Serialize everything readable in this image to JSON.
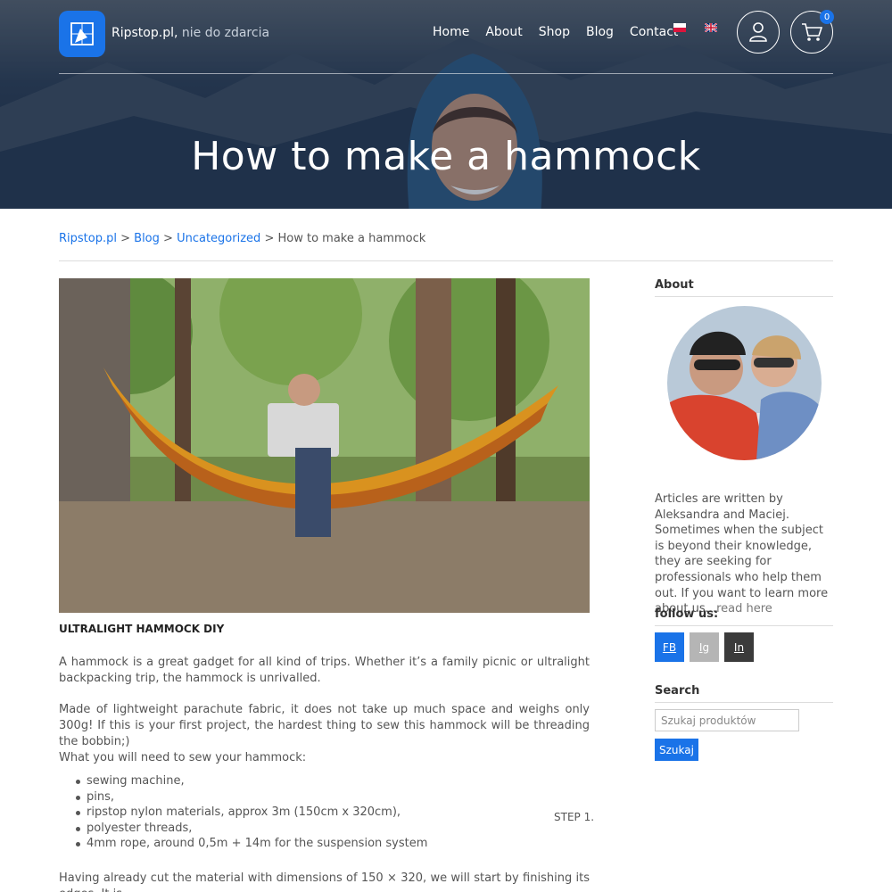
{
  "brand": {
    "name": "Ripstop.pl,",
    "tagline": "nie do zdarcia"
  },
  "nav": [
    {
      "label": "Home"
    },
    {
      "label": "About"
    },
    {
      "label": "Shop"
    },
    {
      "label": "Blog"
    },
    {
      "label": "Contact"
    }
  ],
  "cart": {
    "count": "0"
  },
  "hero": {
    "title": "How to make a hammock"
  },
  "breadcrumb": {
    "items": [
      "Ripstop.pl",
      "Blog",
      "Uncategorized"
    ],
    "separator": ">",
    "current": "How to make a hammock"
  },
  "article": {
    "heading": "ULTRALIGHT HAMMOCK DIY",
    "p1": "A hammock is a great gadget for all kind of trips. Whether it’s a family picnic or ultralight backpacking trip, the hammock is unrivalled.",
    "p2": "Made of lightweight parachute fabric, it does not take up much space and weighs only 300g! If this is your first project, the hardest thing to sew this hammock will be threading the bobbin;)",
    "p3": "What you will need to sew your hammock:",
    "list": [
      "sewing machine,",
      "pins,",
      "ripstop nylon materials, approx 3m (150cm x 320cm),",
      "polyester threads,",
      "4mm rope, around 0,5m + 14m for the suspension system"
    ],
    "step": "STEP 1.",
    "p4": "Having already cut the material with dimensions of 150 × 320, we will start by finishing its edges. It is"
  },
  "sidebar": {
    "about_title": "About",
    "about_text": "Articles are written by Aleksandra and Maciej. Sometimes when the subject is beyond their knowledge, they are seeking for professionals who help them out. If you want to learn more about us...",
    "read_more": "read here",
    "follow_title": "follow us:",
    "social": [
      "FB",
      "Ig",
      "In"
    ],
    "search_title": "Search",
    "search_placeholder": "Szukaj produktów",
    "search_button": "Szukaj"
  },
  "colors": {
    "accent": "#1a73e8",
    "hero_dark": "#1b2c44",
    "instagram_gray": "#b5b5b5",
    "linkedin_dark": "#3b3b3b"
  }
}
